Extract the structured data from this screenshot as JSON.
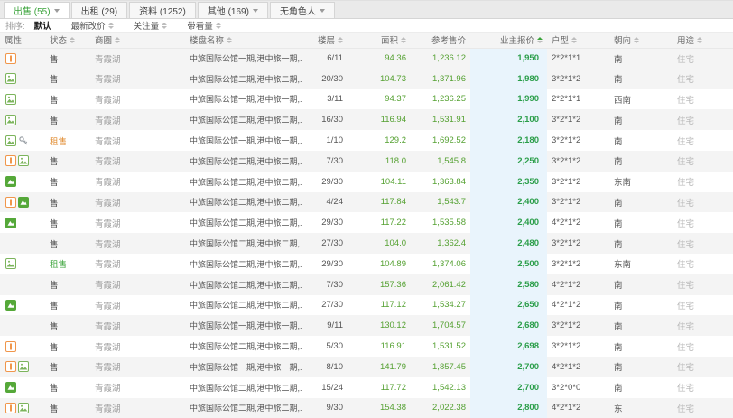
{
  "tabs": [
    {
      "label": "出售 (55)",
      "caret": true,
      "active": true
    },
    {
      "label": "出租 (29)",
      "caret": false,
      "active": false
    },
    {
      "label": "资料 (1252)",
      "caret": false,
      "active": false
    },
    {
      "label": "其他 (169)",
      "caret": true,
      "active": false
    },
    {
      "label": "无角色人",
      "caret": true,
      "active": false
    }
  ],
  "toolbar": {
    "label": "排序:",
    "options": [
      {
        "text": "默认",
        "active": true,
        "sortable": false
      },
      {
        "text": "最新改价",
        "active": false,
        "sortable": true
      },
      {
        "text": "关注量",
        "active": false,
        "sortable": true
      },
      {
        "text": "带看量",
        "active": false,
        "sortable": true
      }
    ]
  },
  "table": {
    "columns": [
      {
        "key": "attrs",
        "label": "属性",
        "sort": false,
        "active": false
      },
      {
        "key": "status",
        "label": "状态",
        "sort": true,
        "active": false
      },
      {
        "key": "district",
        "label": "商圈",
        "sort": true,
        "active": false
      },
      {
        "key": "name",
        "label": "楼盘名称",
        "sort": true,
        "active": false
      },
      {
        "key": "floor",
        "label": "楼层",
        "sort": true,
        "active": false
      },
      {
        "key": "area",
        "label": "面积",
        "sort": true,
        "active": false
      },
      {
        "key": "ref",
        "label": "参考售价",
        "sort": false,
        "active": false
      },
      {
        "key": "owner",
        "label": "业主报价",
        "sort": true,
        "active": true
      },
      {
        "key": "layout",
        "label": "户型",
        "sort": true,
        "active": false
      },
      {
        "key": "facing",
        "label": "朝向",
        "sort": true,
        "active": false
      },
      {
        "key": "usage",
        "label": "用途",
        "sort": true,
        "active": false
      }
    ],
    "rows": [
      {
        "icons": [
          "orange-badge"
        ],
        "status": "售",
        "status_color": "dark",
        "district": "青霞湖",
        "name": "中旅国际公馆一期,港中旅一期,...",
        "floor": "6/11",
        "area": "94.36",
        "ref_price": "1,236.12",
        "owner_price": "1,950",
        "layout": "2*2*1*1",
        "facing": "南",
        "usage": "住宅",
        "hover": true
      },
      {
        "icons": [
          "photo"
        ],
        "status": "售",
        "status_color": "dark",
        "district": "青霞湖",
        "name": "中旅国际公馆二期,港中旅二期,...",
        "floor": "20/30",
        "area": "104.73",
        "ref_price": "1,371.96",
        "owner_price": "1,980",
        "layout": "3*2*1*2",
        "facing": "南",
        "usage": "住宅",
        "hover": false
      },
      {
        "icons": [
          "photo"
        ],
        "status": "售",
        "status_color": "dark",
        "district": "青霞湖",
        "name": "中旅国际公馆一期,港中旅一期,...",
        "floor": "3/11",
        "area": "94.37",
        "ref_price": "1,236.25",
        "owner_price": "1,990",
        "layout": "2*2*1*1",
        "facing": "西南",
        "usage": "住宅",
        "hover": false
      },
      {
        "icons": [
          "photo"
        ],
        "status": "售",
        "status_color": "dark",
        "district": "青霞湖",
        "name": "中旅国际公馆二期,港中旅二期,...",
        "floor": "16/30",
        "area": "116.94",
        "ref_price": "1,531.91",
        "owner_price": "2,100",
        "layout": "3*2*1*2",
        "facing": "南",
        "usage": "住宅",
        "hover": false
      },
      {
        "icons": [
          "photo",
          "key"
        ],
        "status": "租售",
        "status_color": "orange",
        "district": "青霞湖",
        "name": "中旅国际公馆一期,港中旅一期,...",
        "floor": "1/10",
        "area": "129.2",
        "ref_price": "1,692.52",
        "owner_price": "2,180",
        "layout": "3*2*1*2",
        "facing": "南",
        "usage": "住宅",
        "hover": false
      },
      {
        "icons": [
          "orange-badge",
          "photo"
        ],
        "status": "售",
        "status_color": "dark",
        "district": "青霞湖",
        "name": "中旅国际公馆二期,港中旅二期,...",
        "floor": "7/30",
        "area": "118.0",
        "ref_price": "1,545.8",
        "owner_price": "2,250",
        "layout": "3*2*1*2",
        "facing": "南",
        "usage": "住宅",
        "hover": false
      },
      {
        "icons": [
          "video"
        ],
        "status": "售",
        "status_color": "dark",
        "district": "青霞湖",
        "name": "中旅国际公馆二期,港中旅二期,...",
        "floor": "29/30",
        "area": "104.11",
        "ref_price": "1,363.84",
        "owner_price": "2,350",
        "layout": "3*2*1*2",
        "facing": "东南",
        "usage": "住宅",
        "hover": false
      },
      {
        "icons": [
          "orange-badge",
          "video"
        ],
        "status": "售",
        "status_color": "dark",
        "district": "青霞湖",
        "name": "中旅国际公馆二期,港中旅二期,...",
        "floor": "4/24",
        "area": "117.84",
        "ref_price": "1,543.7",
        "owner_price": "2,400",
        "layout": "3*2*1*2",
        "facing": "南",
        "usage": "住宅",
        "hover": false
      },
      {
        "icons": [
          "video"
        ],
        "status": "售",
        "status_color": "dark",
        "district": "青霞湖",
        "name": "中旅国际公馆二期,港中旅二期,...",
        "floor": "29/30",
        "area": "117.22",
        "ref_price": "1,535.58",
        "owner_price": "2,400",
        "layout": "4*2*1*2",
        "facing": "南",
        "usage": "住宅",
        "hover": false
      },
      {
        "icons": [],
        "status": "售",
        "status_color": "dark",
        "district": "青霞湖",
        "name": "中旅国际公馆二期,港中旅二期,...",
        "floor": "27/30",
        "area": "104.0",
        "ref_price": "1,362.4",
        "owner_price": "2,480",
        "layout": "3*2*1*2",
        "facing": "南",
        "usage": "住宅",
        "hover": false
      },
      {
        "icons": [
          "photo"
        ],
        "status": "租售",
        "status_color": "green",
        "district": "青霞湖",
        "name": "中旅国际公馆二期,港中旅二期,...",
        "floor": "29/30",
        "area": "104.89",
        "ref_price": "1,374.06",
        "owner_price": "2,500",
        "layout": "3*2*1*2",
        "facing": "东南",
        "usage": "住宅",
        "hover": false
      },
      {
        "icons": [],
        "status": "售",
        "status_color": "dark",
        "district": "青霞湖",
        "name": "中旅国际公馆二期,港中旅二期,...",
        "floor": "7/30",
        "area": "157.36",
        "ref_price": "2,061.42",
        "owner_price": "2,580",
        "layout": "4*2*1*2",
        "facing": "南",
        "usage": "住宅",
        "hover": false
      },
      {
        "icons": [
          "video"
        ],
        "status": "售",
        "status_color": "dark",
        "district": "青霞湖",
        "name": "中旅国际公馆二期,港中旅二期,...",
        "floor": "27/30",
        "area": "117.12",
        "ref_price": "1,534.27",
        "owner_price": "2,650",
        "layout": "4*2*1*2",
        "facing": "南",
        "usage": "住宅",
        "hover": false
      },
      {
        "icons": [],
        "status": "售",
        "status_color": "dark",
        "district": "青霞湖",
        "name": "中旅国际公馆一期,港中旅一期,...",
        "floor": "9/11",
        "area": "130.12",
        "ref_price": "1,704.57",
        "owner_price": "2,680",
        "layout": "3*2*1*2",
        "facing": "南",
        "usage": "住宅",
        "hover": false
      },
      {
        "icons": [
          "orange-badge"
        ],
        "status": "售",
        "status_color": "dark",
        "district": "青霞湖",
        "name": "中旅国际公馆二期,港中旅二期,...",
        "floor": "5/30",
        "area": "116.91",
        "ref_price": "1,531.52",
        "owner_price": "2,698",
        "layout": "3*2*1*2",
        "facing": "南",
        "usage": "住宅",
        "hover": false
      },
      {
        "icons": [
          "orange-badge",
          "photo"
        ],
        "status": "售",
        "status_color": "dark",
        "district": "青霞湖",
        "name": "中旅国际公馆一期,港中旅一期,...",
        "floor": "8/10",
        "area": "141.79",
        "ref_price": "1,857.45",
        "owner_price": "2,700",
        "layout": "4*2*1*2",
        "facing": "南",
        "usage": "住宅",
        "hover": false
      },
      {
        "icons": [
          "video"
        ],
        "status": "售",
        "status_color": "dark",
        "district": "青霞湖",
        "name": "中旅国际公馆二期,港中旅二期,...",
        "floor": "15/24",
        "area": "117.72",
        "ref_price": "1,542.13",
        "owner_price": "2,700",
        "layout": "3*2*0*0",
        "facing": "南",
        "usage": "住宅",
        "hover": false
      },
      {
        "icons": [
          "orange-badge",
          "photo"
        ],
        "status": "售",
        "status_color": "dark",
        "district": "青霞湖",
        "name": "中旅国际公馆二期,港中旅二期,...",
        "floor": "9/30",
        "area": "154.38",
        "ref_price": "2,022.38",
        "owner_price": "2,800",
        "layout": "4*2*1*2",
        "facing": "东",
        "usage": "住宅",
        "hover": false
      }
    ]
  },
  "colors": {
    "accent_green": "#3aa33a",
    "value_green": "#55a132",
    "price_green": "#2b9e4a",
    "status_orange": "#e08a2e",
    "owner_price_column_bg": "#e9f4fc",
    "zebra_row_bg": "#f4f4f4",
    "header_bg": "#f4f4f4"
  }
}
